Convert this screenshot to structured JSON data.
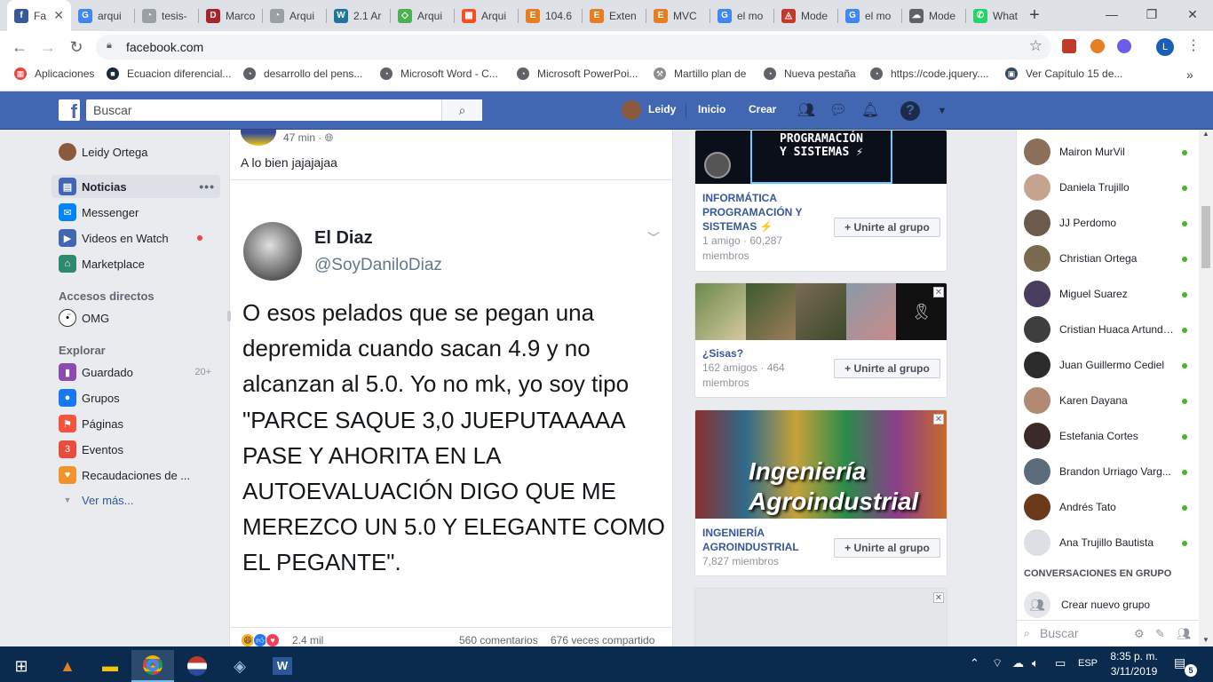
{
  "browser": {
    "tabs": [
      {
        "label": "Fa",
        "color": "#3b5998",
        "glyph": "f",
        "active": true
      },
      {
        "label": "arqui",
        "color": "#4285f4",
        "glyph": "G"
      },
      {
        "label": "tesis-",
        "color": "#9aa0a6",
        "glyph": "◔"
      },
      {
        "label": "Marco",
        "color": "#a4262c",
        "glyph": "D"
      },
      {
        "label": "Arqui",
        "color": "#9aa0a6",
        "glyph": "◔"
      },
      {
        "label": "2.1 Ar",
        "color": "#21759b",
        "glyph": "W"
      },
      {
        "label": "Arqui",
        "color": "#4caf50",
        "glyph": "◇"
      },
      {
        "label": "Arqui",
        "color": "#f25022",
        "glyph": "▦"
      },
      {
        "label": "104.6",
        "color": "#e67e22",
        "glyph": "E"
      },
      {
        "label": "Exten",
        "color": "#e67e22",
        "glyph": "E"
      },
      {
        "label": "MVC",
        "color": "#e67e22",
        "glyph": "E"
      },
      {
        "label": "el mo",
        "color": "#4285f4",
        "glyph": "G"
      },
      {
        "label": "Mode",
        "color": "#c0392b",
        "glyph": "◬"
      },
      {
        "label": "el mo",
        "color": "#4285f4",
        "glyph": "G"
      },
      {
        "label": "Mode",
        "color": "#5f6368",
        "glyph": "☁"
      },
      {
        "label": "What",
        "color": "#25d366",
        "glyph": "✆"
      }
    ],
    "new_tab": "+",
    "window": {
      "minimize": "—",
      "maximize": "❐",
      "close": "✕"
    },
    "url": "facebook.com",
    "profile_initial": "L",
    "bookmarks": [
      {
        "label": "Aplicaciones",
        "color": "#e8453c",
        "glyph": "▦"
      },
      {
        "label": "Ecuacion diferencial...",
        "color": "#1b2a3a",
        "glyph": "■"
      },
      {
        "label": "desarrollo del pens...",
        "color": "#5f6368",
        "glyph": "◔"
      },
      {
        "label": "Microsoft Word - C...",
        "color": "#5f6368",
        "glyph": "◔"
      },
      {
        "label": "Microsoft PowerPoi...",
        "color": "#5f6368",
        "glyph": "◔"
      },
      {
        "label": "Martillo plan de",
        "color": "#8e8e8e",
        "glyph": "⚒"
      },
      {
        "label": "Nueva pestaña",
        "color": "#5f6368",
        "glyph": "◔"
      },
      {
        "label": "https://code.jquery....",
        "color": "#5f6368",
        "glyph": "◔"
      },
      {
        "label": "Ver Capítulo 15 de...",
        "color": "#34495e",
        "glyph": "▣"
      }
    ],
    "bookmarks_more": "»"
  },
  "fb": {
    "logo": "f",
    "search_placeholder": "Buscar",
    "user_name": "Leidy",
    "nav_home": "Inicio",
    "nav_create": "Crear"
  },
  "leftnav": {
    "profile": "Leidy Ortega",
    "items": [
      {
        "label": "Noticias",
        "color": "#4267b2",
        "glyph": "▤"
      },
      {
        "label": "Messenger",
        "color": "#0084ff",
        "glyph": "✉"
      },
      {
        "label": "Videos en Watch",
        "color": "#4267b2",
        "glyph": "▶"
      },
      {
        "label": "Marketplace",
        "color": "#2d8a6e",
        "glyph": "⌂"
      }
    ],
    "more_dots": "•••",
    "shortcuts_header": "Accesos directos",
    "shortcut": "OMG",
    "explore_header": "Explorar",
    "explore": [
      {
        "label": "Guardado",
        "count": "20+",
        "color": "#8c4bb0",
        "glyph": "▮"
      },
      {
        "label": "Grupos",
        "color": "#1877f2",
        "glyph": "●"
      },
      {
        "label": "Páginas",
        "color": "#f5533d",
        "glyph": "⚑"
      },
      {
        "label": "Eventos",
        "color": "#e74c3c",
        "glyph": "3"
      },
      {
        "label": "Recaudaciones de ...",
        "color": "#f0932b",
        "glyph": "♥"
      }
    ],
    "see_more": "Ver más..."
  },
  "post": {
    "time": "47 min ·",
    "text": "A lo bien jajajajaa",
    "tweet_name": "El Diaz",
    "tweet_handle": "@SoyDaniloDiaz",
    "tweet_body": "O esos pelados que se pegan una depremida cuando sacan 4.9 y no alcanzan al 5.0. Yo no mk, yo soy tipo \"PARCE SAQUE 3,0 JUEPUTAAAAA PASE Y AHORITA EN LA AUTOEVALUACIÓN DIGO QUE ME MEREZCO UN 5.0 Y ELEGANTE COMO EL PEGANTE\".",
    "reactions": "2.4 mil",
    "comments": "560 comentarios",
    "shares": "676 veces compartido"
  },
  "groups": [
    {
      "title": "INFORMÁTICA PROGRAMACIÓN Y SISTEMAS ⚡",
      "meta": "1 amigo · 60,287 miembros",
      "join": "+ Unirte al grupo",
      "banner": "PROGRAMACIÓN\nY SISTEMAS ⚡"
    },
    {
      "title": "¿Sisas?",
      "meta": "162 amigos · 464 miembros",
      "join": "+ Unirte al grupo"
    },
    {
      "title": "INGENIERÍA AGROINDUSTRIAL",
      "meta": "7,827 miembros",
      "join": "+ Unirte al grupo",
      "banner": "Ingeniería Agroindustrial"
    }
  ],
  "chat": {
    "contacts": [
      {
        "name": "Mairon MurVil",
        "color": "#8b6f5a"
      },
      {
        "name": "Daniela Trujillo",
        "color": "#c4a48e"
      },
      {
        "name": "JJ Perdomo",
        "color": "#6d5b4b"
      },
      {
        "name": "Christian Ortega",
        "color": "#7a6a4f"
      },
      {
        "name": "Miguel Suarez",
        "color": "#4a3e5e"
      },
      {
        "name": "Cristian Huaca Artundu...",
        "color": "#3e3e3e"
      },
      {
        "name": "Juan Guillermo Cediel",
        "color": "#2c2c2c"
      },
      {
        "name": "Karen Dayana",
        "color": "#b08a72"
      },
      {
        "name": "Estefania Cortes",
        "color": "#3a2a2a"
      },
      {
        "name": "Brandon Urriago Varg...",
        "color": "#5b6b7a"
      },
      {
        "name": "Andrés Tato",
        "color": "#6a3a1a"
      },
      {
        "name": "Ana Trujillo Bautista",
        "color": "#dcdfe4"
      }
    ],
    "group_header": "CONVERSACIONES EN GRUPO",
    "new_group": "Crear nuevo grupo",
    "search_placeholder": "Buscar"
  },
  "taskbar": {
    "lang": "ESP",
    "time": "8:35 p. m.",
    "date": "3/11/2019",
    "notifications": "5"
  }
}
